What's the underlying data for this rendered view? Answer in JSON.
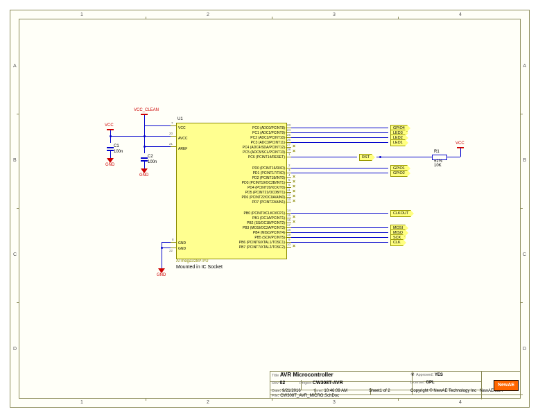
{
  "column_numbers": [
    "1",
    "2",
    "3",
    "4"
  ],
  "row_letters": [
    "A",
    "B",
    "C",
    "D"
  ],
  "title_block": {
    "title_label": "Title",
    "title_value": "AVR Microcontroller",
    "approved_label": "Approved",
    "approved_value": "YES",
    "rev_label": "Rev",
    "rev_value": "02",
    "project_label": "Project",
    "project_value": "CW308T-AVR",
    "license_label": "License",
    "license_value": "GPL",
    "date_label": "Date",
    "date_value": "9/21/2016",
    "time_label": "Time",
    "time_value": "10:46:09 AM",
    "sheet_label": "Sheet1",
    "sheet_of": "of  2",
    "copyright": "Copyright © NewAE Technology Inc",
    "url": "NewAE.com",
    "file_label": "File",
    "file_value": "CW308T_AVR_MICRO.SchDoc",
    "logo": "NewAE"
  },
  "power": {
    "vcc_clean": "VCC_CLEAN",
    "vcc": "VCC",
    "gnd": "GND"
  },
  "caps": {
    "c1_ref": "C1",
    "c1_val": "100n",
    "c2_ref": "C2",
    "c2_val": "100n"
  },
  "r1": {
    "ref": "R1",
    "tol": "±1%",
    "val": "10K"
  },
  "chip": {
    "ref": "U1",
    "part": "ATmega328P-PU",
    "note": "Mounted in IC Socket",
    "left_pins": [
      {
        "no": "7",
        "name": "VCC"
      },
      {
        "no": "20",
        "name": "AVCC"
      },
      {
        "no": "21",
        "name": "AREF"
      },
      {
        "no": "8",
        "name": "GND"
      },
      {
        "no": "22",
        "name": "GND"
      }
    ],
    "portc": [
      {
        "no": "23",
        "name": "PC0 (ADC0/PCINT8)"
      },
      {
        "no": "24",
        "name": "PC1 (ADC1/PCINT9)"
      },
      {
        "no": "25",
        "name": "PC2 (ADC2/PCINT10)"
      },
      {
        "no": "26",
        "name": "PC3 (ADC3/PCINT11)"
      },
      {
        "no": "27",
        "name": "PC4 (ADC4/SDA/PCINT12)"
      },
      {
        "no": "28",
        "name": "PC5 (ADC5/SCL/PCINT13)"
      },
      {
        "no": "1",
        "name": "PC6 (PCINT14/RESET)"
      }
    ],
    "portd": [
      {
        "no": "2",
        "name": "PD0 (PCINT16/RXD)"
      },
      {
        "no": "3",
        "name": "PD1 (PCINT17/TXD)"
      },
      {
        "no": "4",
        "name": "PD2 (PCINT18/INT0)"
      },
      {
        "no": "5",
        "name": "PD3 (PCINT19/OC2B/INT1)"
      },
      {
        "no": "6",
        "name": "PD4 (PCINT20/XCK/T0)"
      },
      {
        "no": "11",
        "name": "PD5 (PCINT21/OC0B/T1)"
      },
      {
        "no": "12",
        "name": "PD6 (PCINT22/OC0A/AIN0)"
      },
      {
        "no": "13",
        "name": "PD7 (PCINT23/AIN1)"
      }
    ],
    "portb": [
      {
        "no": "14",
        "name": "PB0 (PCINT0/CLKO/ICP1)"
      },
      {
        "no": "15",
        "name": "PB1 (OC1A/PCINT1)"
      },
      {
        "no": "16",
        "name": "PB2 (SS/OC1B/PCINT2)"
      },
      {
        "no": "17",
        "name": "PB3 (MOSI/OC2A/PCINT3)"
      },
      {
        "no": "18",
        "name": "PB4 (MISO/PCINT4)"
      },
      {
        "no": "19",
        "name": "PB5 (SCK/PCINT5)"
      },
      {
        "no": "9",
        "name": "PB6 (PCINT6/XTAL1/TOSC1)"
      },
      {
        "no": "10",
        "name": "PB7 (PCINT7/XTAL2/TOSC2)"
      }
    ]
  },
  "net_labels": {
    "gpio4": "GPIO4",
    "led3": "LED3",
    "led2": "LED2",
    "led1": "LED1",
    "rst": "RST",
    "gpio1": "GPIO1",
    "gpio2": "GPIO2",
    "clkout": "CLKOUT",
    "mosi": "MOSI",
    "miso": "MISO",
    "sck": "SCK",
    "clk": "CLK"
  }
}
